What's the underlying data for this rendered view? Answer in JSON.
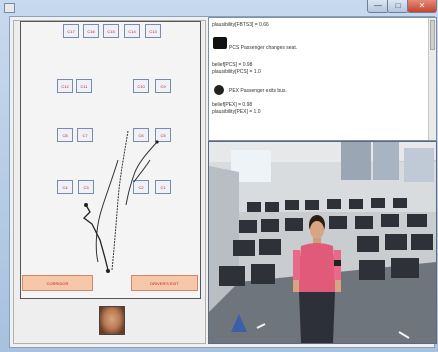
{
  "seat_ids": {
    "top_row": [
      "C17",
      "C16",
      "C15",
      "C14",
      "C13"
    ],
    "row2_left": [
      "C12",
      "C11"
    ],
    "row2_right": [
      "C10",
      "C9"
    ],
    "row3_left": [
      "C8",
      "C7"
    ],
    "row3_right": [
      "C6",
      "C5"
    ],
    "row4_left": [
      "C4",
      "C3"
    ],
    "row4_right": [
      "C2",
      "C1"
    ]
  },
  "doors": {
    "left": "CORRIDOR",
    "right": "DRIVER'S EXIT"
  },
  "log": {
    "line1": "plausibility[FBTS3] = 0.66",
    "event1": "PCS   Passenger changes seat.",
    "line2": "belief[PCS] = 0.98",
    "line3": "plausibility[PCS] = 1.0",
    "event2": "PEX   Passenger exits bus.",
    "line4": "belief[PEX] = 0.98",
    "line5": "plausibility[PEX] = 1.0"
  },
  "icons": {
    "event1": "seat-change-icon",
    "event2": "exit-icon",
    "face": "passenger-face-thumbnail"
  }
}
